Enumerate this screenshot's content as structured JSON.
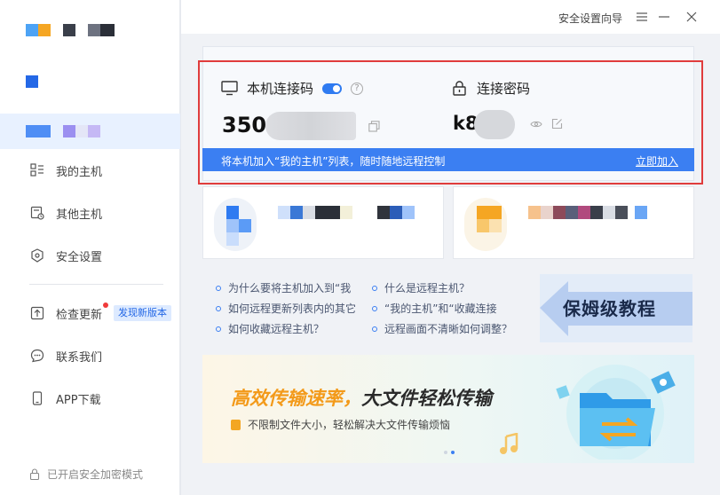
{
  "window": {
    "setup_wizard_label": "安全设置向导",
    "menu_icon": "menu-icon",
    "minimize_icon": "minimize-icon",
    "close_icon": "close-icon"
  },
  "sidebar": {
    "items": [
      {
        "label": "我的主机",
        "icon": "host-list-icon"
      },
      {
        "label": "其他主机",
        "icon": "other-host-icon"
      },
      {
        "label": "安全设置",
        "icon": "shield-icon"
      },
      {
        "label": "检查更新",
        "icon": "update-icon",
        "badge": "发现新版本"
      },
      {
        "label": "联系我们",
        "icon": "chat-icon"
      },
      {
        "label": "APP下载",
        "icon": "phone-icon"
      }
    ],
    "secure_mode_label": "已开启安全加密模式"
  },
  "connect": {
    "code_title": "本机连接码",
    "code_value": "350",
    "password_title": "连接密码",
    "password_value": "k8",
    "bar_text": "将本机加入“我的主机”列表，随时随地远程控制",
    "bar_link": "立即加入"
  },
  "faq": {
    "left": [
      "为什么要将主机加入到“我",
      "如何远程更新列表内的其它",
      "如何收藏远程主机？"
    ],
    "right": [
      "什么是远程主机？",
      "“我的主机”和“收藏连接",
      "远程画面不清晰如何调整？"
    ],
    "tutorial_label": "保姆级教程"
  },
  "banner": {
    "title_part1": "高效传输速率",
    "title_sep": "，",
    "title_part2": "大文件轻松传输",
    "subtitle": "不限制文件大小，轻松解决大文件传输烦恼"
  },
  "colors": {
    "accent": "#3b7ff2",
    "highlight_border": "#e03c3c",
    "banner_highlight": "#f39a1a"
  }
}
